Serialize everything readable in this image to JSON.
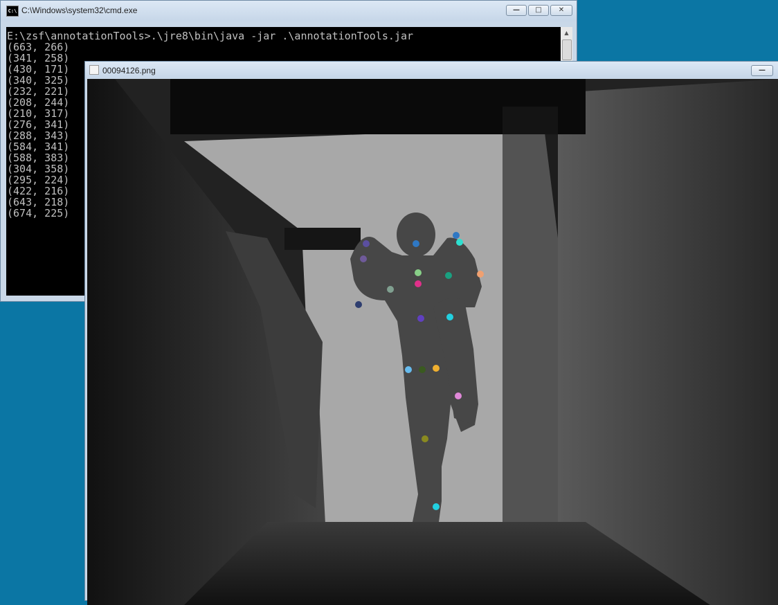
{
  "cmd": {
    "title": "C:\\Windows\\system32\\cmd.exe",
    "icon_text": "C:\\",
    "command": "E:\\zsf\\annotationTools>.\\jre8\\bin\\java -jar .\\annotationTools.jar",
    "output_lines": [
      "(663, 266)",
      "(341, 258)",
      "(430, 171)",
      "(340, 325)",
      "(232, 221)",
      "(208, 244)",
      "(210, 317)",
      "(276, 341)",
      "(288, 343)",
      "(584, 341)",
      "(588, 383)",
      "(304, 358)",
      "(295, 224)",
      "(422, 216)",
      "(643, 218)",
      "(674, 225)"
    ],
    "buttons": {
      "minimize": "—",
      "maximize": "□",
      "close": "✕"
    }
  },
  "viewer": {
    "title": "00094126.png",
    "buttons": {
      "minimize": "—"
    },
    "keypoints": [
      {
        "color": "#5b4fa0"
      },
      {
        "color": "#2f78c4"
      },
      {
        "color": "#2f78c4"
      },
      {
        "color": "#6f5a9a"
      },
      {
        "color": "#2ee0d0"
      },
      {
        "color": "#f0a070"
      },
      {
        "color": "#88d088"
      },
      {
        "color": "#e0308a"
      },
      {
        "color": "#1aa080"
      },
      {
        "color": "#2e3e70"
      },
      {
        "color": "#80a090"
      },
      {
        "color": "#6040c0"
      },
      {
        "color": "#22d0e0"
      },
      {
        "color": "#66bbee"
      },
      {
        "color": "#3a5a20"
      },
      {
        "color": "#f0b030"
      },
      {
        "color": "#e088d8"
      },
      {
        "color": "#8a8a20"
      },
      {
        "color": "#22d0e0"
      }
    ]
  }
}
